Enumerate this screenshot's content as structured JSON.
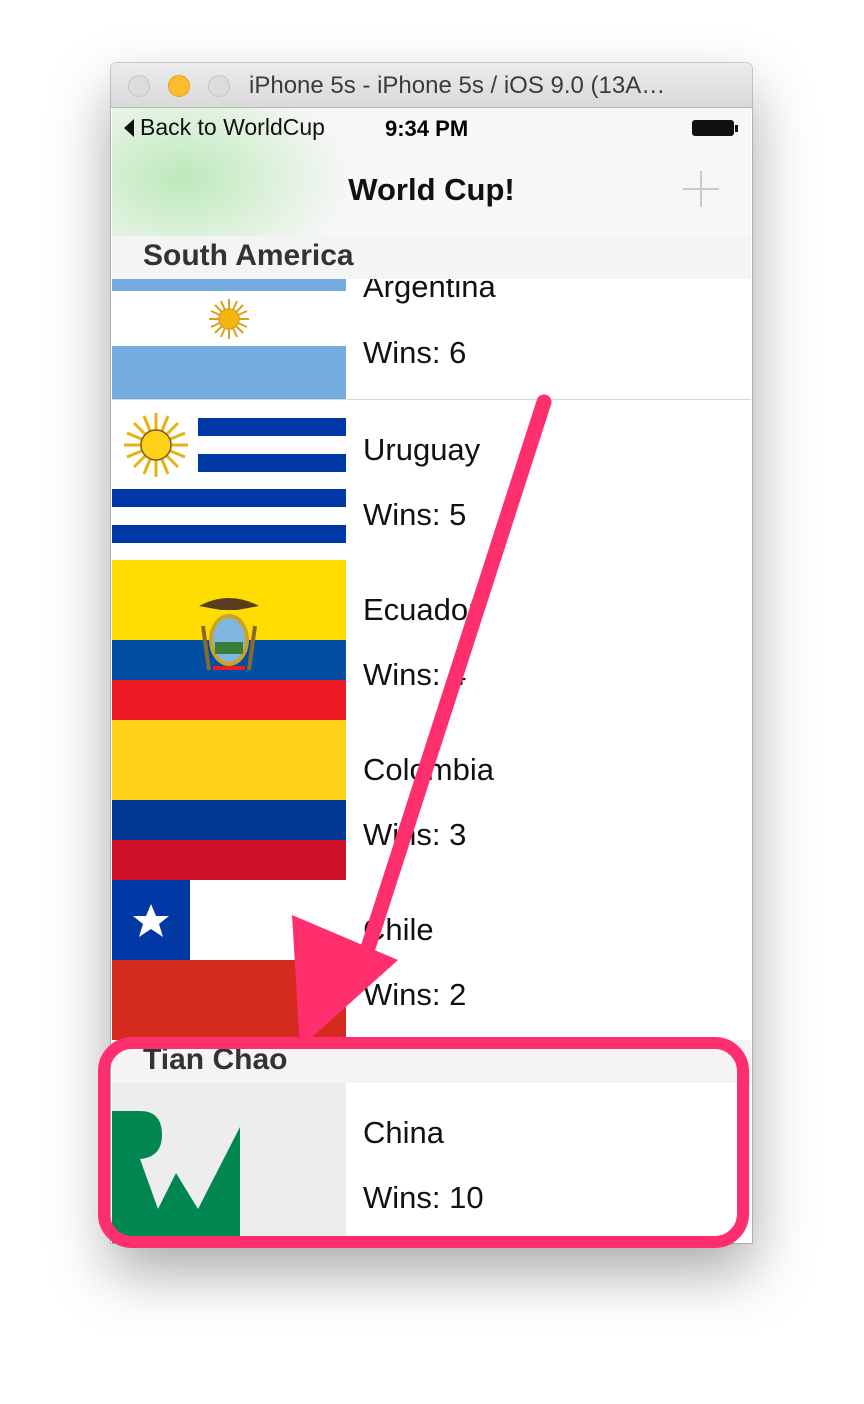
{
  "window": {
    "title": "iPhone 5s - iPhone 5s / iOS 9.0 (13A…",
    "traffic_lights": [
      "close",
      "minimize",
      "zoom"
    ]
  },
  "status_bar": {
    "back_label": "Back to WorldCup",
    "time": "9:34 PM",
    "battery_icon": "battery-icon"
  },
  "navbar": {
    "title": "World Cup!",
    "add_icon": "plus-icon"
  },
  "sections": [
    {
      "header": "South America",
      "rows": [
        {
          "country": "Argentina",
          "wins": "Wins: 6",
          "flag_icon": "argentina-flag-icon"
        },
        {
          "country": "Uruguay",
          "wins": "Wins: 5",
          "flag_icon": "uruguay-flag-icon"
        },
        {
          "country": "Ecuador",
          "wins": "Wins: 4",
          "flag_icon": "ecuador-flag-icon"
        },
        {
          "country": "Colombia",
          "wins": "Wins: 3",
          "flag_icon": "colombia-flag-icon"
        },
        {
          "country": "Chile",
          "wins": "Wins: 2",
          "flag_icon": "chile-flag-icon"
        }
      ]
    },
    {
      "header": "Tian Chao",
      "rows": [
        {
          "country": "China",
          "wins": "Wins: 10",
          "flag_icon": "rw-logo-placeholder-icon"
        }
      ]
    }
  ],
  "colors": {
    "annotation": "#ff2f6e",
    "argentina_blue": "#74acdf",
    "uruguay_blue": "#0038a8",
    "ecuador_yellow": "#ffdd00",
    "ecuador_blue": "#034ea2",
    "ecuador_red": "#ed1c24",
    "colombia_yellow": "#fcd116",
    "colombia_blue": "#003893",
    "colombia_red": "#ce1126",
    "chile_blue": "#0039a6",
    "chile_red": "#d52b1e",
    "rw_green": "#008751"
  }
}
